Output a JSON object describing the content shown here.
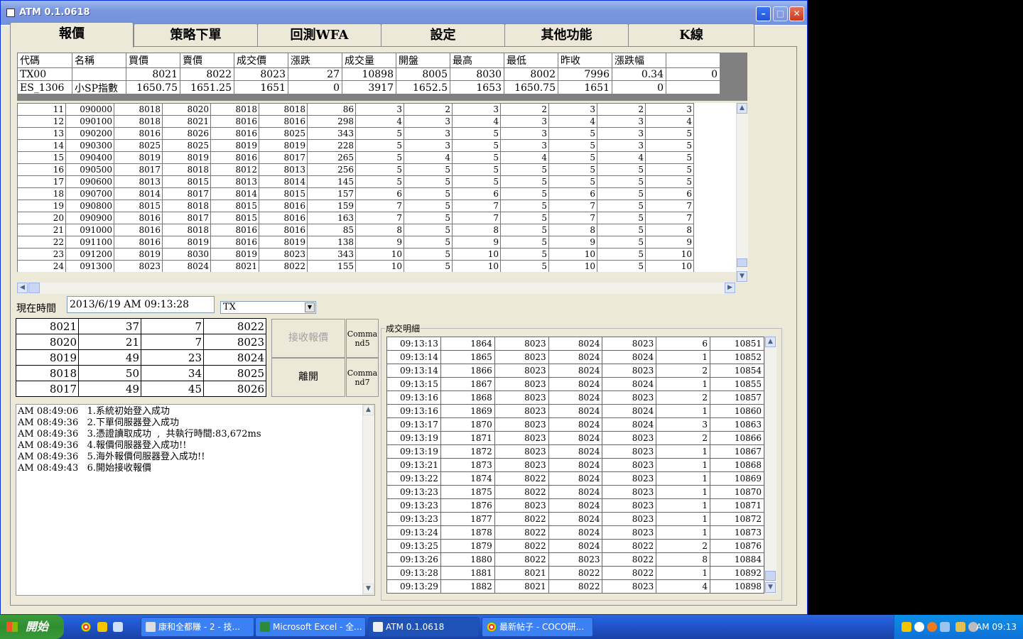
{
  "window": {
    "title": "ATM 0.1.0618"
  },
  "tabs": [
    "報價",
    "策略下單",
    "回測WFA",
    "設定",
    "其他功能",
    "K線"
  ],
  "quote": {
    "headers": [
      "代碼",
      "名稱",
      "買價",
      "賣價",
      "成交價",
      "漲跌",
      "成交量",
      "開盤",
      "最高",
      "最低",
      "昨收",
      "漲跌幅",
      ""
    ],
    "rows": [
      [
        "TX00",
        "",
        "8021",
        "8022",
        "8023",
        "27",
        "10898",
        "8005",
        "8030",
        "8002",
        "7996",
        "0.34",
        "0"
      ],
      [
        "ES_1306",
        "小SP指數",
        "1650.75",
        "1651.25",
        "1651",
        "0",
        "3917",
        "1652.5",
        "1653",
        "1650.75",
        "1651",
        "0",
        ""
      ]
    ]
  },
  "bars": [
    [
      "11",
      "090000",
      "8018",
      "8020",
      "8018",
      "8018",
      "86",
      "3",
      "2",
      "3",
      "2",
      "3",
      "2",
      "3"
    ],
    [
      "12",
      "090100",
      "8018",
      "8021",
      "8016",
      "8016",
      "298",
      "4",
      "3",
      "4",
      "3",
      "4",
      "3",
      "4"
    ],
    [
      "13",
      "090200",
      "8016",
      "8026",
      "8016",
      "8025",
      "343",
      "5",
      "3",
      "5",
      "3",
      "5",
      "3",
      "5"
    ],
    [
      "14",
      "090300",
      "8025",
      "8025",
      "8019",
      "8019",
      "228",
      "5",
      "3",
      "5",
      "3",
      "5",
      "3",
      "5"
    ],
    [
      "15",
      "090400",
      "8019",
      "8019",
      "8016",
      "8017",
      "265",
      "5",
      "4",
      "5",
      "4",
      "5",
      "4",
      "5"
    ],
    [
      "16",
      "090500",
      "8017",
      "8018",
      "8012",
      "8013",
      "256",
      "5",
      "5",
      "5",
      "5",
      "5",
      "5",
      "5"
    ],
    [
      "17",
      "090600",
      "8013",
      "8015",
      "8013",
      "8014",
      "145",
      "5",
      "5",
      "5",
      "5",
      "5",
      "5",
      "5"
    ],
    [
      "18",
      "090700",
      "8014",
      "8017",
      "8014",
      "8015",
      "157",
      "6",
      "5",
      "6",
      "5",
      "6",
      "5",
      "6"
    ],
    [
      "19",
      "090800",
      "8015",
      "8018",
      "8015",
      "8016",
      "159",
      "7",
      "5",
      "7",
      "5",
      "7",
      "5",
      "7"
    ],
    [
      "20",
      "090900",
      "8016",
      "8017",
      "8015",
      "8016",
      "163",
      "7",
      "5",
      "7",
      "5",
      "7",
      "5",
      "7"
    ],
    [
      "21",
      "091000",
      "8016",
      "8018",
      "8016",
      "8016",
      "85",
      "8",
      "5",
      "8",
      "5",
      "8",
      "5",
      "8"
    ],
    [
      "22",
      "091100",
      "8016",
      "8019",
      "8016",
      "8019",
      "138",
      "9",
      "5",
      "9",
      "5",
      "9",
      "5",
      "9"
    ],
    [
      "23",
      "091200",
      "8019",
      "8030",
      "8019",
      "8023",
      "343",
      "10",
      "5",
      "10",
      "5",
      "10",
      "5",
      "10"
    ],
    [
      "24",
      "091300",
      "8023",
      "8024",
      "8021",
      "8022",
      "155",
      "10",
      "5",
      "10",
      "5",
      "10",
      "5",
      "10"
    ]
  ],
  "time_label": "現在時間",
  "time_value": "2013/6/19 AM 09:13:28",
  "symbol_select": "TX",
  "depth": [
    [
      "8021",
      "37",
      "7",
      "8022"
    ],
    [
      "8020",
      "21",
      "7",
      "8023"
    ],
    [
      "8019",
      "49",
      "23",
      "8024"
    ],
    [
      "8018",
      "50",
      "34",
      "8025"
    ],
    [
      "8017",
      "49",
      "45",
      "8026"
    ]
  ],
  "buttons": {
    "receive": "接收報價",
    "cmd5": "Command5",
    "leave": "離開",
    "cmd7": "Command7"
  },
  "log": [
    "AM 08:49:06   1.系統初始登入成功",
    "AM 08:49:36   2.下單伺服器登入成功",
    "AM 08:49:36   3.憑證讀取成功  ,  共執行時間:83,672ms",
    "AM 08:49:36   4.報價伺服器登入成功!!",
    "AM 08:49:36   5.海外報價伺服器登入成功!!",
    "AM 08:49:43   6.開始接收報價"
  ],
  "trades_label": "成交明細",
  "trades": [
    [
      "09:13:13",
      "1864",
      "8023",
      "8024",
      "8023",
      "6",
      "10851"
    ],
    [
      "09:13:14",
      "1865",
      "8023",
      "8024",
      "8024",
      "1",
      "10852"
    ],
    [
      "09:13:14",
      "1866",
      "8023",
      "8024",
      "8023",
      "2",
      "10854"
    ],
    [
      "09:13:15",
      "1867",
      "8023",
      "8024",
      "8024",
      "1",
      "10855"
    ],
    [
      "09:13:16",
      "1868",
      "8023",
      "8024",
      "8023",
      "2",
      "10857"
    ],
    [
      "09:13:16",
      "1869",
      "8023",
      "8024",
      "8024",
      "1",
      "10860"
    ],
    [
      "09:13:17",
      "1870",
      "8023",
      "8024",
      "8024",
      "3",
      "10863"
    ],
    [
      "09:13:19",
      "1871",
      "8023",
      "8024",
      "8023",
      "2",
      "10866"
    ],
    [
      "09:13:19",
      "1872",
      "8023",
      "8024",
      "8023",
      "1",
      "10867"
    ],
    [
      "09:13:21",
      "1873",
      "8023",
      "8024",
      "8023",
      "1",
      "10868"
    ],
    [
      "09:13:22",
      "1874",
      "8022",
      "8024",
      "8023",
      "1",
      "10869"
    ],
    [
      "09:13:23",
      "1875",
      "8022",
      "8024",
      "8023",
      "1",
      "10870"
    ],
    [
      "09:13:23",
      "1876",
      "8023",
      "8024",
      "8023",
      "1",
      "10871"
    ],
    [
      "09:13:23",
      "1877",
      "8022",
      "8024",
      "8023",
      "1",
      "10872"
    ],
    [
      "09:13:24",
      "1878",
      "8022",
      "8024",
      "8023",
      "1",
      "10873"
    ],
    [
      "09:13:25",
      "1879",
      "8022",
      "8024",
      "8022",
      "2",
      "10876"
    ],
    [
      "09:13:26",
      "1880",
      "8022",
      "8023",
      "8022",
      "8",
      "10884"
    ],
    [
      "09:13:28",
      "1881",
      "8021",
      "8022",
      "8022",
      "1",
      "10892"
    ],
    [
      "09:13:29",
      "1882",
      "8021",
      "8022",
      "8023",
      "4",
      "10898"
    ]
  ],
  "taskbar": {
    "start": "開始",
    "tasks": [
      "康和全都賺 - 2 - 技...",
      "Microsoft Excel - 全...",
      "ATM 0.1.0618",
      "最新帖子 - COCO研..."
    ],
    "clock": "AM 09:13"
  }
}
